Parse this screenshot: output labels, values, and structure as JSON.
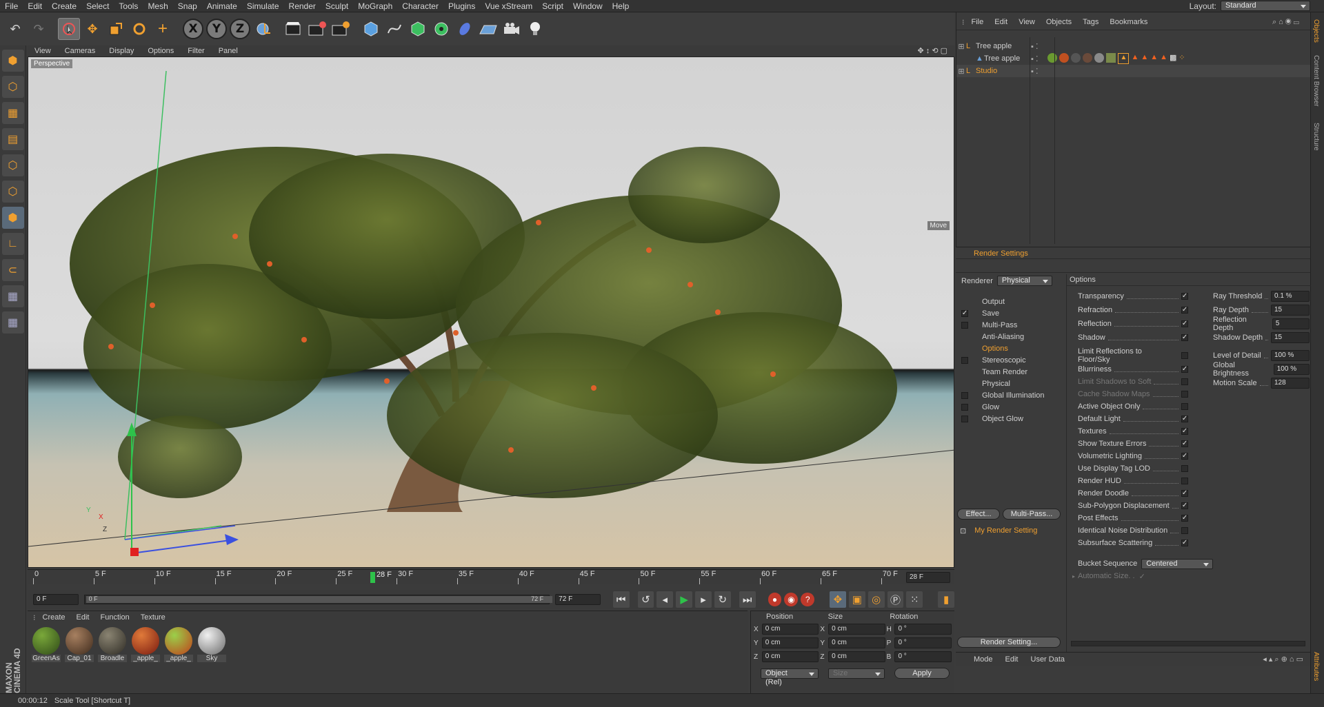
{
  "menubar": {
    "items": [
      "File",
      "Edit",
      "Create",
      "Select",
      "Tools",
      "Mesh",
      "Snap",
      "Animate",
      "Simulate",
      "Render",
      "Sculpt",
      "MoGraph",
      "Character",
      "Plugins",
      "Vue xStream",
      "Script",
      "Window",
      "Help"
    ],
    "layout_label": "Layout:",
    "layout_value": "Standard"
  },
  "toolbar": {
    "icons": [
      "undo-icon",
      "redo-icon",
      "live-selection-icon",
      "move-icon",
      "scale-icon",
      "rotate-icon",
      "last-tool-icon",
      "x-axis-icon",
      "y-axis-icon",
      "z-axis-icon",
      "world-coordinates-icon",
      "render-view-icon",
      "render-picture-viewer-icon",
      "edit-render-settings-icon",
      "cube-icon",
      "spline-pen-icon",
      "subdivision-icon",
      "array-icon",
      "deformer-icon",
      "floor-icon",
      "camera-icon",
      "light-icon"
    ],
    "x_axis": "X",
    "y_axis": "Y",
    "z_axis": "Z"
  },
  "viewport": {
    "menu": [
      "View",
      "Cameras",
      "Display",
      "Options",
      "Filter",
      "Panel"
    ],
    "label": "Perspective",
    "move_label": "Move"
  },
  "timeline": {
    "ticks": [
      "0",
      "5 F",
      "10 F",
      "15 F",
      "20 F",
      "25 F",
      "30 F",
      "35 F",
      "40 F",
      "45 F",
      "50 F",
      "55 F",
      "60 F",
      "65 F",
      "70 F"
    ],
    "cursor_label": "28 F",
    "current_frame": 28,
    "max_frame": 72,
    "current_field": "28 F"
  },
  "playbar": {
    "start": "0 F",
    "range_start": "0 F",
    "range_end": "72 F",
    "end": "72 F"
  },
  "materials": {
    "menu": [
      "Create",
      "Edit",
      "Function",
      "Texture"
    ],
    "items": [
      {
        "name": "GreenAs",
        "c1": "#7aa83a",
        "c2": "#2f4a18"
      },
      {
        "name": "Cap_01",
        "c1": "#a78060",
        "c2": "#3e2a1c"
      },
      {
        "name": "Broadle",
        "c1": "#8a8472",
        "c2": "#2e2b24"
      },
      {
        "name": "_apple_",
        "c1": "#e07a3a",
        "c2": "#7a1a10"
      },
      {
        "name": "_apple_",
        "c1": "#9ad04a",
        "c2": "#c0401a"
      },
      {
        "name": "Sky",
        "c1": "#f0f0f0",
        "c2": "#6a6a6a"
      }
    ]
  },
  "coords": {
    "headers": [
      "Position",
      "Size",
      "Rotation"
    ],
    "rows": [
      {
        "a": "X",
        "p": "0 cm",
        "b": "X",
        "s": "0 cm",
        "c": "H",
        "r": "0 °"
      },
      {
        "a": "Y",
        "p": "0 cm",
        "b": "Y",
        "s": "0 cm",
        "c": "P",
        "r": "0 °"
      },
      {
        "a": "Z",
        "p": "0 cm",
        "b": "Z",
        "s": "0 cm",
        "c": "B",
        "r": "0 °"
      }
    ],
    "mode": "Object (Rel)",
    "size_mode": "Size",
    "apply": "Apply"
  },
  "status": {
    "time": "00:00:12",
    "text": "Scale Tool [Shortcut T]"
  },
  "maxon": "MAXON CINEMA 4D",
  "objects": {
    "menu": [
      "File",
      "Edit",
      "View",
      "Objects",
      "Tags",
      "Bookmarks"
    ],
    "rows": [
      "Tree apple",
      "Tree apple",
      "Studio"
    ]
  },
  "right_tabs": [
    "Objects",
    "Content Browser",
    "Structure",
    "Attributes"
  ],
  "render_settings": {
    "title": "Render Settings",
    "renderer_label": "Renderer",
    "renderer": "Physical",
    "items": [
      {
        "label": "Output",
        "cb": false,
        "check": false
      },
      {
        "label": "Save",
        "cb": true,
        "check": true
      },
      {
        "label": "Multi-Pass",
        "cb": true,
        "check": false
      },
      {
        "label": "Anti-Aliasing",
        "cb": false,
        "check": false
      },
      {
        "label": "Options",
        "cb": false,
        "check": false,
        "active": true
      },
      {
        "label": "Stereoscopic",
        "cb": true,
        "check": false
      },
      {
        "label": "Team Render",
        "cb": false,
        "check": false
      },
      {
        "label": "Physical",
        "cb": false,
        "check": false
      },
      {
        "label": "Global Illumination",
        "cb": true,
        "check": false
      },
      {
        "label": "Glow",
        "cb": true,
        "check": false
      },
      {
        "label": "Object Glow",
        "cb": true,
        "check": false
      }
    ],
    "effect_btn": "Effect...",
    "multipass_btn": "Multi-Pass...",
    "my_setting": "My Render Setting",
    "render_setting_btn": "Render Setting...",
    "options_title": "Options",
    "options_left": [
      {
        "label": "Transparency",
        "check": true
      },
      {
        "label": "Refraction",
        "check": true
      },
      {
        "label": "Reflection",
        "check": true
      },
      {
        "label": "Shadow",
        "check": true
      },
      {
        "label": "Limit Reflections to Floor/Sky",
        "check": false
      },
      {
        "label": "Blurriness",
        "check": true
      },
      {
        "label": "Limit Shadows to Soft",
        "check": false,
        "dim": true
      },
      {
        "label": "Cache Shadow Maps",
        "check": false,
        "dim": true
      },
      {
        "label": "Active Object Only",
        "check": false
      },
      {
        "label": "Default Light",
        "check": true
      },
      {
        "label": "Textures",
        "check": true
      },
      {
        "label": "Show Texture Errors",
        "check": true
      },
      {
        "label": "Volumetric Lighting",
        "check": true
      },
      {
        "label": "Use Display Tag LOD",
        "check": false
      },
      {
        "label": "Render HUD",
        "check": false
      },
      {
        "label": "Render Doodle",
        "check": true
      },
      {
        "label": "Sub-Polygon Displacement",
        "check": true
      },
      {
        "label": "Post Effects",
        "check": true
      },
      {
        "label": "Identical Noise Distribution",
        "check": false
      },
      {
        "label": "Subsurface Scattering",
        "check": true
      }
    ],
    "options_right": [
      {
        "label": "Ray Threshold",
        "value": "0.1 %"
      },
      {
        "label": "Ray Depth",
        "value": "15"
      },
      {
        "label": "Reflection Depth",
        "value": "5"
      },
      {
        "label": "Shadow Depth",
        "value": "15"
      },
      {
        "label": "Level of Detail",
        "value": "100 %"
      },
      {
        "label": "Global Brightness",
        "value": "100 %"
      },
      {
        "label": "Motion Scale",
        "value": "128"
      }
    ],
    "bucket_label": "Bucket Sequence",
    "bucket_value": "Centered",
    "auto_size": "Automatic Size. ."
  },
  "attributes": {
    "menu": [
      "Mode",
      "Edit",
      "User Data"
    ]
  }
}
